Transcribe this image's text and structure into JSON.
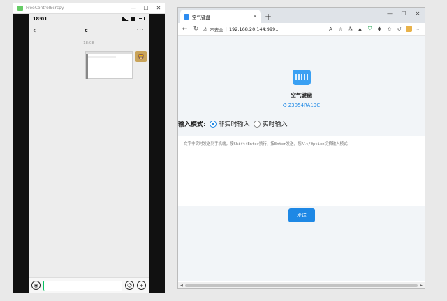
{
  "scrcpy": {
    "title": "FreeControlScrcpy",
    "controls": {
      "minimize": "—",
      "maximize": "☐",
      "close": "✕"
    }
  },
  "phone": {
    "status_time": "18:01",
    "chat_title": "c",
    "back_icon": "‹",
    "more_icon": "···",
    "message_time": "18:08",
    "input_value": ""
  },
  "browser": {
    "tab_title": "空气键盘",
    "tab_close": "✕",
    "new_tab": "+",
    "controls": {
      "minimize": "—",
      "maximize": "☐",
      "close": "✕"
    },
    "security_label": "不安全",
    "separator": "|",
    "url": "192.168.20.144:999...",
    "nav": {
      "back": "←",
      "refresh": "↻"
    }
  },
  "page": {
    "app_title": "空气键盘",
    "device_id": "23054RA19C",
    "mode_label": "输入模式:",
    "mode_options": [
      "非实时输入",
      "实时输入"
    ],
    "selected_mode": "非实时输入",
    "placeholder": "文字非实时发送到手机端，按Shift+Enter换行，按Enter发送，按Alt/Option切换输入模式",
    "send_label": "发送"
  },
  "colors": {
    "accent": "#1e88e5",
    "page_bg": "#f2f5f8",
    "phone_bg": "#ededed"
  }
}
